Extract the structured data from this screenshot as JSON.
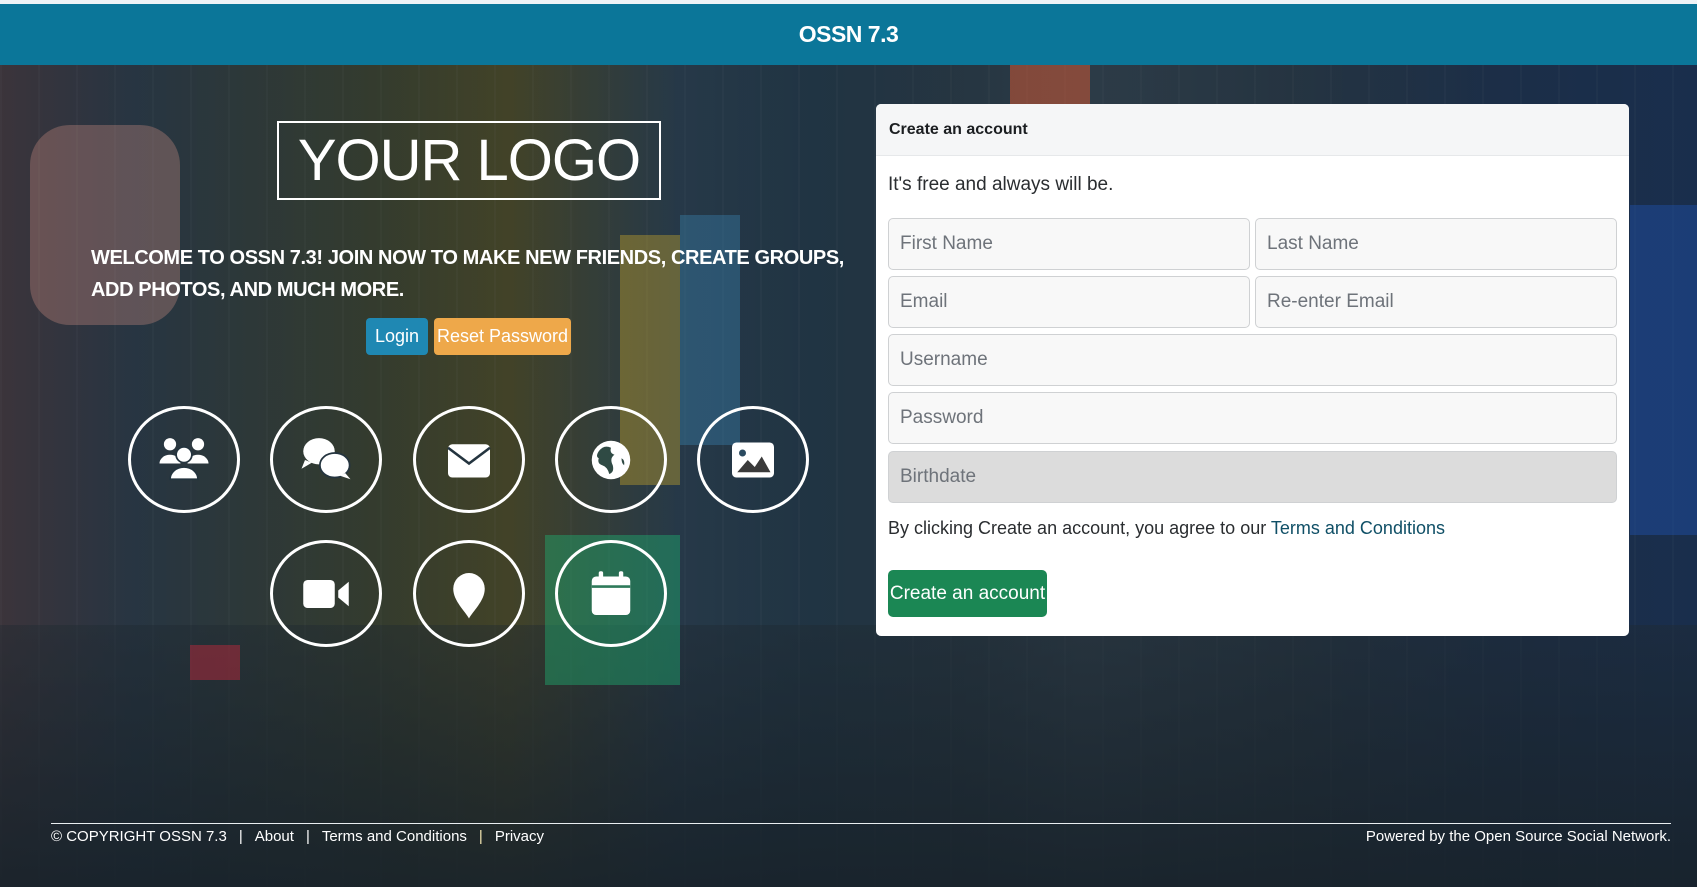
{
  "header": {
    "title": "OSSN 7.3"
  },
  "hero": {
    "logo_text": "YOUR LOGO",
    "welcome_text": "WELCOME TO OSSN 7.3! JOIN NOW TO MAKE NEW FRIENDS, CREATE GROUPS, ADD PHOTOS, AND MUCH MORE.",
    "login_label": "Login",
    "reset_password_label": "Reset Password",
    "features": [
      {
        "icon": "users-icon"
      },
      {
        "icon": "comments-icon"
      },
      {
        "icon": "envelope-icon"
      },
      {
        "icon": "globe-icon"
      },
      {
        "icon": "image-icon"
      },
      {
        "icon": "video-icon"
      },
      {
        "icon": "map-marker-icon"
      },
      {
        "icon": "calendar-icon"
      }
    ]
  },
  "signup": {
    "title": "Create an account",
    "tagline": "It's free and always will be.",
    "fields": {
      "first_name": {
        "placeholder": "First Name",
        "value": ""
      },
      "last_name": {
        "placeholder": "Last Name",
        "value": ""
      },
      "email": {
        "placeholder": "Email",
        "value": ""
      },
      "email_confirm": {
        "placeholder": "Re-enter Email",
        "value": ""
      },
      "username": {
        "placeholder": "Username",
        "value": ""
      },
      "password": {
        "placeholder": "Password",
        "value": ""
      },
      "birthdate": {
        "placeholder": "Birthdate",
        "value": ""
      }
    },
    "terms_prefix": "By clicking Create an account, you agree to our ",
    "terms_link": "Terms and Conditions",
    "submit_label": "Create an account"
  },
  "footer": {
    "copyright": "© COPYRIGHT OSSN 7.3",
    "separator": "|",
    "links": [
      "About",
      "Terms and Conditions",
      "Privacy"
    ],
    "powered_by": "Powered by the Open Source Social Network."
  },
  "colors": {
    "header_bg": "#0b7699",
    "login_button": "#1f88b3",
    "reset_button": "#eea84a",
    "create_button": "#1b8754",
    "terms_link": "#0f4f66",
    "birthdate_bg": "#dcdcdc"
  }
}
